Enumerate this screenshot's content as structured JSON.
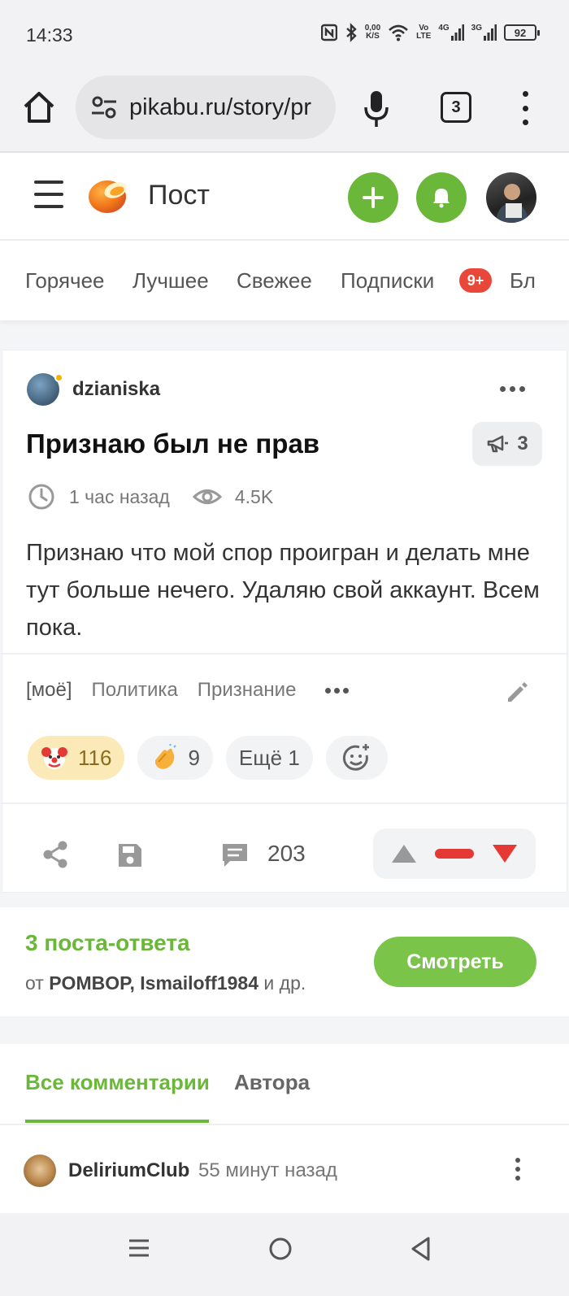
{
  "status_bar": {
    "time": "14:33",
    "net_speed_value": "0,00",
    "net_speed_unit": "K/S",
    "volte_top": "Vo",
    "volte_bottom": "LTE",
    "sig1": "4G",
    "sig2": "3G",
    "battery": "92"
  },
  "browser": {
    "url": "pikabu.ru/story/pr",
    "tab_count": "3"
  },
  "site": {
    "title": "Пост",
    "accent_color": "#6ab73a"
  },
  "nav": {
    "tabs": [
      "Горячее",
      "Лучшее",
      "Свежее",
      "Подписки",
      "Бл"
    ],
    "subscriptions_badge": "9+"
  },
  "post": {
    "author": "dzianiska",
    "title": "Признаю был не прав",
    "shout_count": "3",
    "time_ago": "1 час назад",
    "views": "4.5K",
    "text": "Признаю что мой спор проигран и делать мне тут больше нечего. Удаляю свой аккаунт. Всем пока.",
    "tags": [
      "[моё]",
      "Политика",
      "Признание"
    ],
    "reactions": [
      {
        "icon": "clown-emoji-icon",
        "count": "116"
      },
      {
        "icon": "clapping-hands-emoji-icon",
        "count": "9"
      },
      {
        "label": "Ещё 1"
      }
    ],
    "comment_count": "203"
  },
  "responses": {
    "title": "3 поста-ответа",
    "from_prefix": "от",
    "authors": "POMBOP, Ismailoff1984",
    "from_suffix": "и др.",
    "view_button": "Смотреть"
  },
  "comments": {
    "tabs": [
      "Все комментарии",
      "Автора"
    ],
    "first": {
      "user": "DeliriumClub",
      "time_ago": "55 минут назад"
    }
  }
}
